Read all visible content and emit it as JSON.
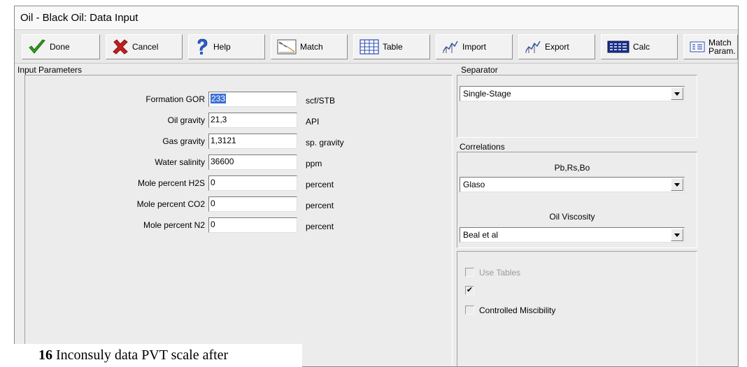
{
  "window": {
    "title": "Oil - Black Oil: Data Input"
  },
  "toolbar": {
    "buttons": [
      {
        "id": "done",
        "label": "Done",
        "icon": "checkmark-icon"
      },
      {
        "id": "cancel",
        "label": "Cancel",
        "icon": "x-icon"
      },
      {
        "id": "help",
        "label": "Help",
        "icon": "question-icon"
      },
      {
        "id": "match",
        "label": "Match",
        "icon": "match-plot-icon"
      },
      {
        "id": "table",
        "label": "Table",
        "icon": "table-icon"
      },
      {
        "id": "import",
        "label": "Import",
        "icon": "import-icon"
      },
      {
        "id": "export",
        "label": "Export",
        "icon": "export-icon"
      },
      {
        "id": "calc",
        "label": "Calc",
        "icon": "calculator-icon"
      },
      {
        "id": "match_param",
        "label": "Match\nParam.",
        "icon": "match-param-icon"
      }
    ]
  },
  "input_parameters": {
    "group_label": "Input Parameters",
    "rows": [
      {
        "label": "Formation GOR",
        "value": "233",
        "unit": "scf/STB",
        "selected": true
      },
      {
        "label": "Oil gravity",
        "value": "21,3",
        "unit": "API"
      },
      {
        "label": "Gas gravity",
        "value": "1,3121",
        "unit": "sp. gravity"
      },
      {
        "label": "Water salinity",
        "value": "36600",
        "unit": "ppm"
      },
      {
        "label": "Mole percent H2S",
        "value": "0",
        "unit": "percent"
      },
      {
        "label": "Mole percent CO2",
        "value": "0",
        "unit": "percent"
      },
      {
        "label": "Mole percent N2",
        "value": "0",
        "unit": "percent"
      }
    ]
  },
  "separator": {
    "group_label": "Separator",
    "value": "Single-Stage"
  },
  "correlations": {
    "group_label": "Correlations",
    "pb_label": "Pb,Rs,Bo",
    "pb_value": "Glaso",
    "visc_label": "Oil Viscosity",
    "visc_value": "Beal et al"
  },
  "options": {
    "use_tables": {
      "label": "Use Tables",
      "checked": false,
      "enabled": false
    },
    "unnamed_check": {
      "checked": true
    },
    "controlled_miscibility": {
      "label": "Controlled Miscibility",
      "checked": false
    }
  },
  "caption": {
    "number": "16",
    "text": " Inconsuly data PVT scale after"
  },
  "colors": {
    "selection": "#3a6fd8",
    "done_check": "#2e9e1a",
    "cancel_x": "#c81e1e",
    "help_q": "#2a5fd0"
  }
}
